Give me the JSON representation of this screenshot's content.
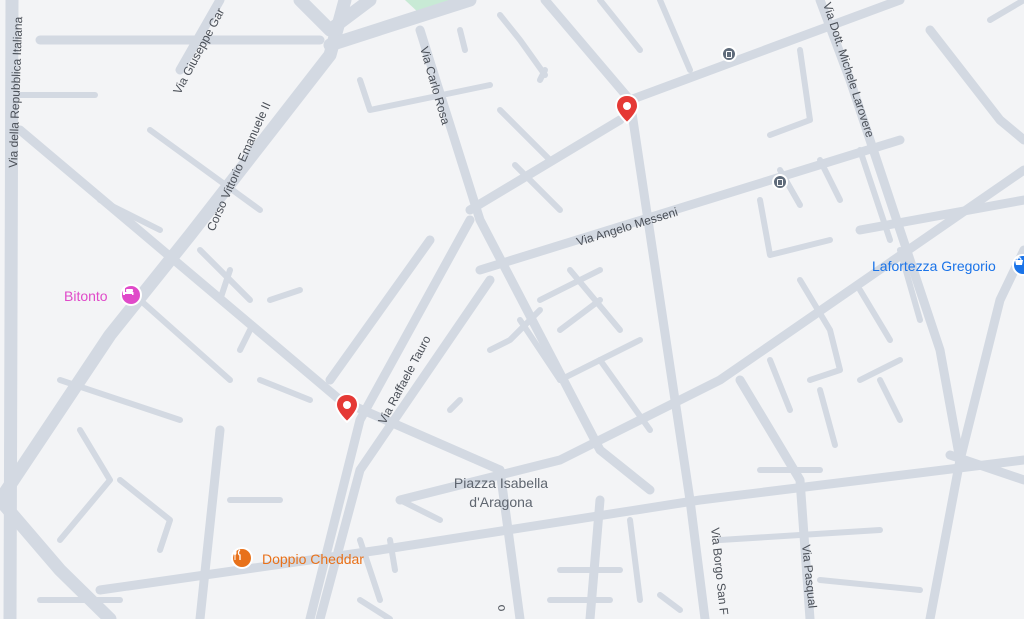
{
  "streets": {
    "via_repubblica": "Via della Repubblica Italiana",
    "via_giuseppe_gar": "Via Giuseppe Gar",
    "corso_vittorio": "Corso Vittorio Emanuele II",
    "via_carlo_rosa": "Via Carlo Rosa",
    "via_angelo_messeni": "Via Angelo Messeni",
    "via_raffaele_tauro": "Via Raffaele Tauro",
    "via_michele_larovere": "Via Dott. Michele Larovere",
    "via_borgo_san": "Via Borgo San F",
    "via_pasqual": "Via Pasqual",
    "via_bottom_stub": "o"
  },
  "places": {
    "piazza_line1": "Piazza Isabella",
    "piazza_line2": "d'Aragona"
  },
  "pois": {
    "bitonto": {
      "label": "Bitonto",
      "icon": "hotel-icon",
      "color": "#e04ac9"
    },
    "lafortezza": {
      "label": "Lafortezza Gregorio",
      "icon": "shop-icon",
      "color": "#1a73e8"
    },
    "doppio_cheddar": {
      "label": "Doppio Cheddar",
      "icon": "restaurant-icon",
      "color": "#e8711a"
    }
  },
  "markers": {
    "pin_color": "#e53935"
  },
  "icons": {
    "bus_stop": "bus-stop-icon",
    "pin": "map-pin-icon"
  }
}
